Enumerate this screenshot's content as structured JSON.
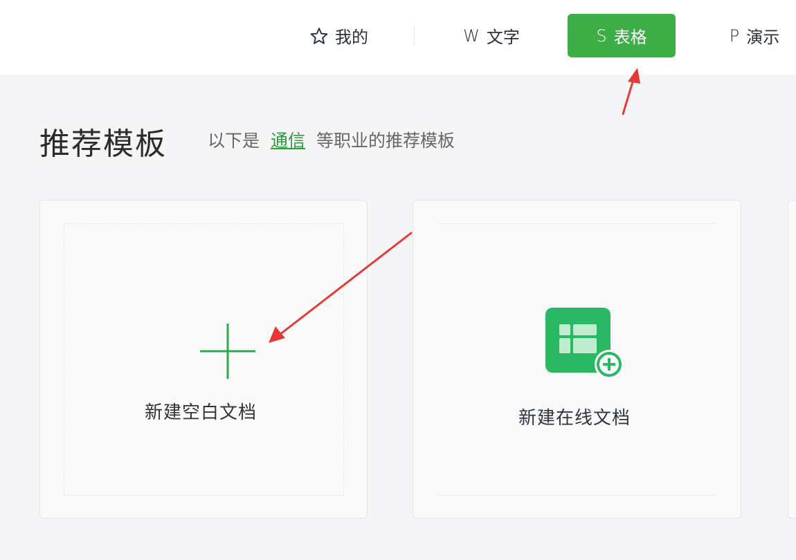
{
  "tabs": [
    {
      "id": "mine",
      "label": "我的",
      "icon": "star-icon"
    },
    {
      "id": "text",
      "label": "文字",
      "icon": "w-letter-icon",
      "icon_char": "W"
    },
    {
      "id": "sheet",
      "label": "表格",
      "icon": "s-letter-icon",
      "icon_char": "S",
      "active": true
    },
    {
      "id": "presentation",
      "label": "演示",
      "icon": "p-letter-icon",
      "icon_char": "P"
    }
  ],
  "section": {
    "title": "推荐模板",
    "subtitle_prefix": "以下是",
    "subtitle_link": "通信",
    "subtitle_suffix": "等职业的推荐模板"
  },
  "cards": {
    "blank": {
      "label": "新建空白文档",
      "icon": "plus-icon"
    },
    "online": {
      "label": "新建在线文档",
      "icon": "spreadsheet-add-icon"
    }
  },
  "colors": {
    "accent_green": "#3dae45",
    "link_green": "#2c9e3a",
    "sheet_icon_green": "#2bb865",
    "annotation_red": "#e53935"
  }
}
